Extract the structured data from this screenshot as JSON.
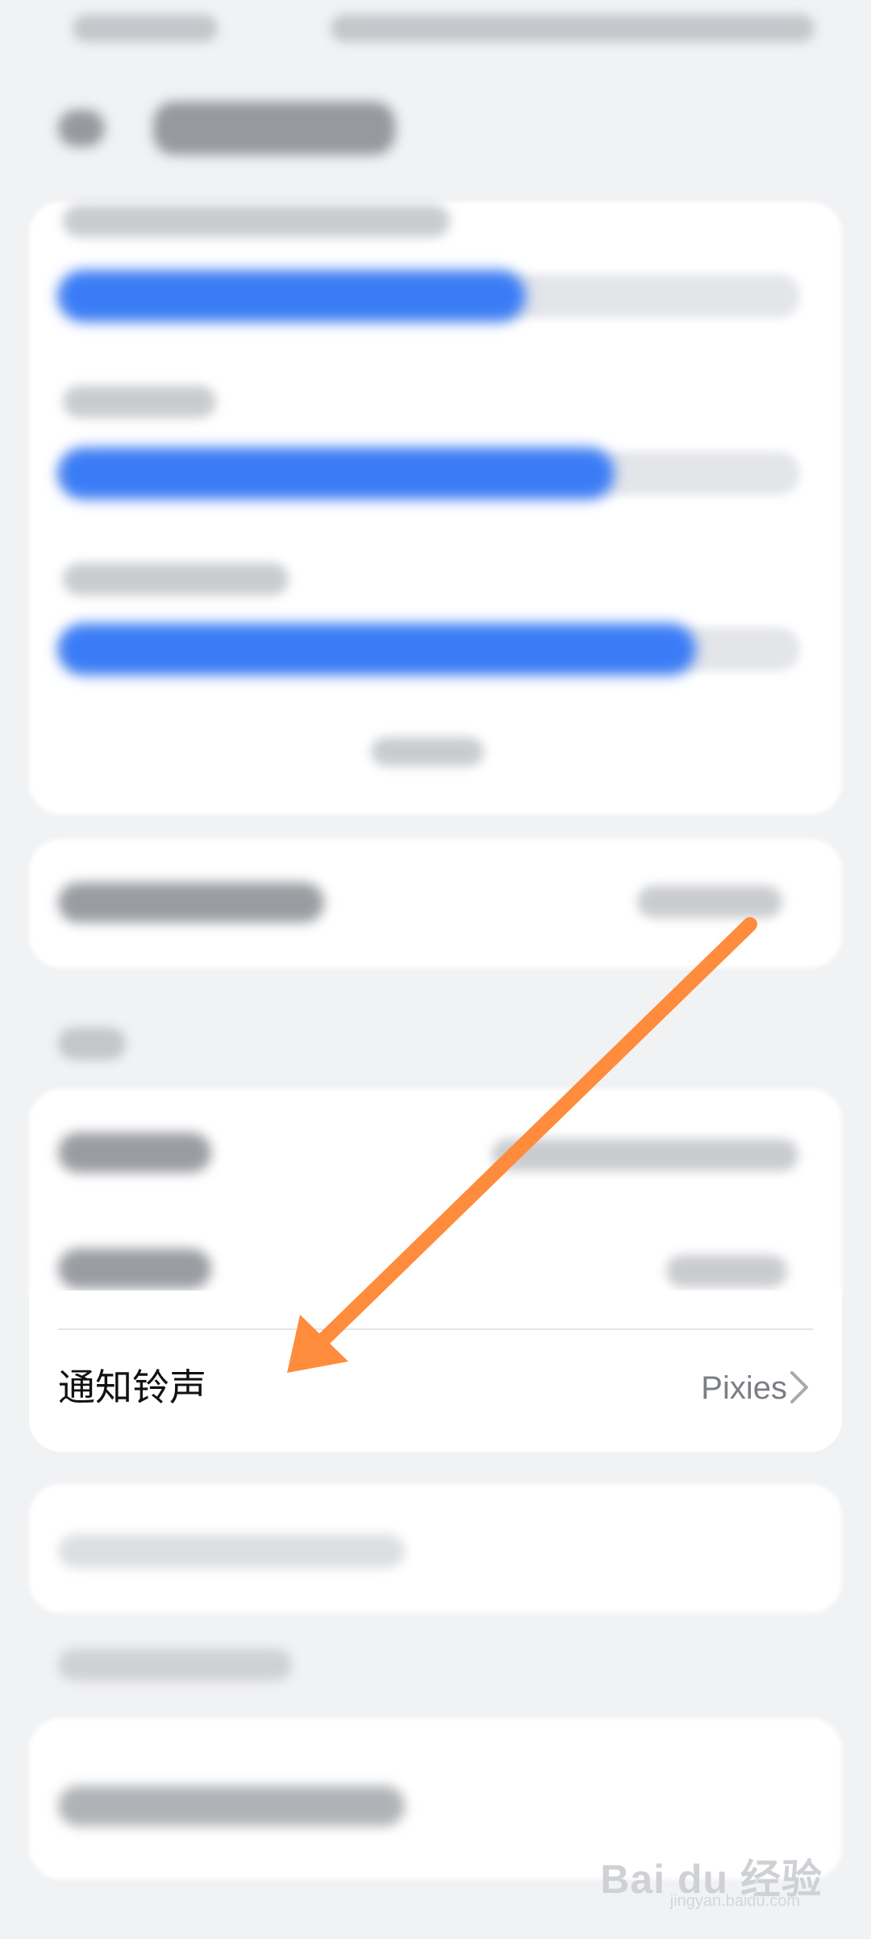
{
  "colors": {
    "background": "#f1f2f4",
    "card": "#ffffff",
    "accent_blue": "#3a7cf6",
    "annotation_arrow": "#ff8c3c",
    "label_text": "#111111",
    "value_text": "#7b7e84"
  },
  "sliders": [
    {
      "name": "volume-slider-1",
      "level": 0.63
    },
    {
      "name": "volume-slider-2",
      "level": 0.75
    },
    {
      "name": "volume-slider-3",
      "level": 0.86
    }
  ],
  "notification_row": {
    "label": "通知铃声",
    "value": "Pixies",
    "chevron_icon": "chevron-right-icon"
  },
  "annotation": {
    "icon": "arrow-annotation-icon"
  },
  "watermark": {
    "text": "Bai du 经验",
    "subtext": "jingyan.baidu.com"
  }
}
